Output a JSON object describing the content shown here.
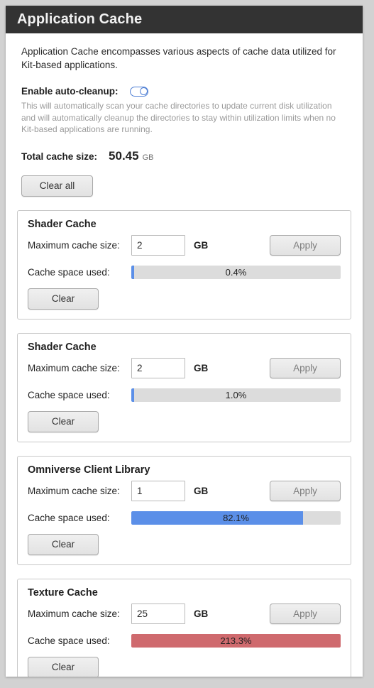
{
  "window": {
    "title": "Application Cache"
  },
  "intro": "Application Cache encompasses various aspects of cache data utilized for Kit-based applications.",
  "auto_cleanup": {
    "label": "Enable auto-cleanup:",
    "toggle_state": "on",
    "description": "This will automatically scan your cache directories to update current disk utilization and will automatically cleanup the directories to stay within utilization limits when no Kit-based applications are running."
  },
  "total_cache": {
    "label": "Total cache size:",
    "value": "50.45",
    "unit": "GB"
  },
  "clear_all_label": "Clear all",
  "labels": {
    "max_cache_size": "Maximum cache size:",
    "unit": "GB",
    "cache_space_used": "Cache space used:",
    "apply": "Apply",
    "clear": "Clear"
  },
  "colors": {
    "bar_normal": "#5b8fe8",
    "bar_over": "#cf6a6e",
    "bar_track": "#dcdcdc",
    "titlebar": "#333333",
    "toggle_accent": "#4f7fd4"
  },
  "groups": [
    {
      "title": "Shader Cache",
      "max_size": "2",
      "unit": "GB",
      "used_pct_text": "0.4%",
      "used_pct": 0.4,
      "over": false
    },
    {
      "title": "Shader Cache",
      "max_size": "2",
      "unit": "GB",
      "used_pct_text": "1.0%",
      "used_pct": 1.0,
      "over": false
    },
    {
      "title": "Omniverse Client Library",
      "max_size": "1",
      "unit": "GB",
      "used_pct_text": "82.1%",
      "used_pct": 82.1,
      "over": false
    },
    {
      "title": "Texture Cache",
      "max_size": "25",
      "unit": "GB",
      "used_pct_text": "213.3%",
      "used_pct": 213.3,
      "over": true
    }
  ]
}
